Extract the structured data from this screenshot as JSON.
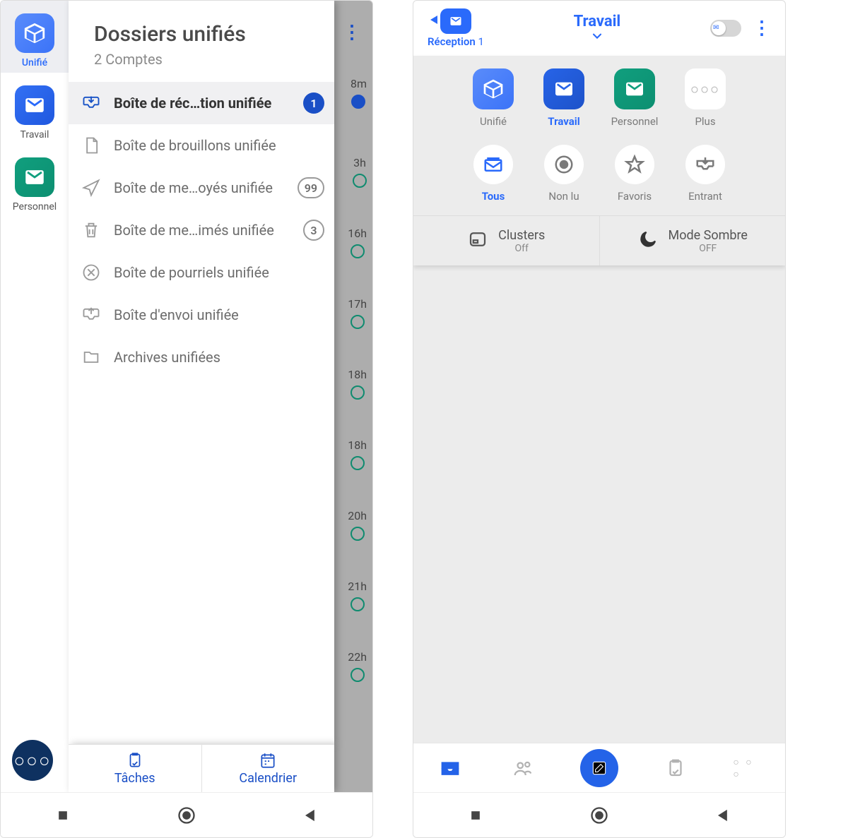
{
  "left": {
    "accounts": [
      {
        "label": "Unifié",
        "type": "unified"
      },
      {
        "label": "Travail",
        "type": "travail"
      },
      {
        "label": "Personnel",
        "type": "personnel"
      }
    ],
    "drawer": {
      "title": "Dossiers unifiés",
      "subtitle": "2 Comptes",
      "folders": [
        {
          "label": "Boîte de réc…tion unifiée",
          "badge": "1",
          "badge_style": "solid",
          "icon": "inbox"
        },
        {
          "label": "Boîte de brouillons unifiée",
          "icon": "draft"
        },
        {
          "label": "Boîte de me…oyés unifiée",
          "badge": "99",
          "badge_style": "outline",
          "icon": "sent"
        },
        {
          "label": "Boîte de me…imés unifiée",
          "badge": "3",
          "badge_style": "outline",
          "icon": "trash"
        },
        {
          "label": "Boîte de pourriels unifiée",
          "icon": "spam"
        },
        {
          "label": "Boîte d'envoi unifiée",
          "icon": "outbox"
        },
        {
          "label": "Archives unifiées",
          "icon": "folder"
        }
      ],
      "bottom": {
        "tasks": "Tâches",
        "calendar": "Calendrier"
      }
    },
    "behind_times": [
      "8m",
      "3h",
      "16h",
      "17h",
      "18h",
      "18h",
      "20h",
      "21h",
      "22h"
    ]
  },
  "right": {
    "top": {
      "brand_label": "Réception",
      "brand_count": "1",
      "title": "Travail"
    },
    "account_tiles": [
      {
        "label": "Unifié",
        "type": "unified"
      },
      {
        "label": "Travail",
        "type": "travail"
      },
      {
        "label": "Personnel",
        "type": "personnel"
      },
      {
        "label": "Plus",
        "type": "plus"
      }
    ],
    "filters": [
      {
        "label": "Tous",
        "icon": "all"
      },
      {
        "label": "Non lu",
        "icon": "unread"
      },
      {
        "label": "Favoris",
        "icon": "star"
      },
      {
        "label": "Entrant",
        "icon": "incoming"
      }
    ],
    "toggles": {
      "clusters_label": "Clusters",
      "clusters_state": "Off",
      "dark_label": "Mode Sombre",
      "dark_state": "OFF"
    }
  }
}
